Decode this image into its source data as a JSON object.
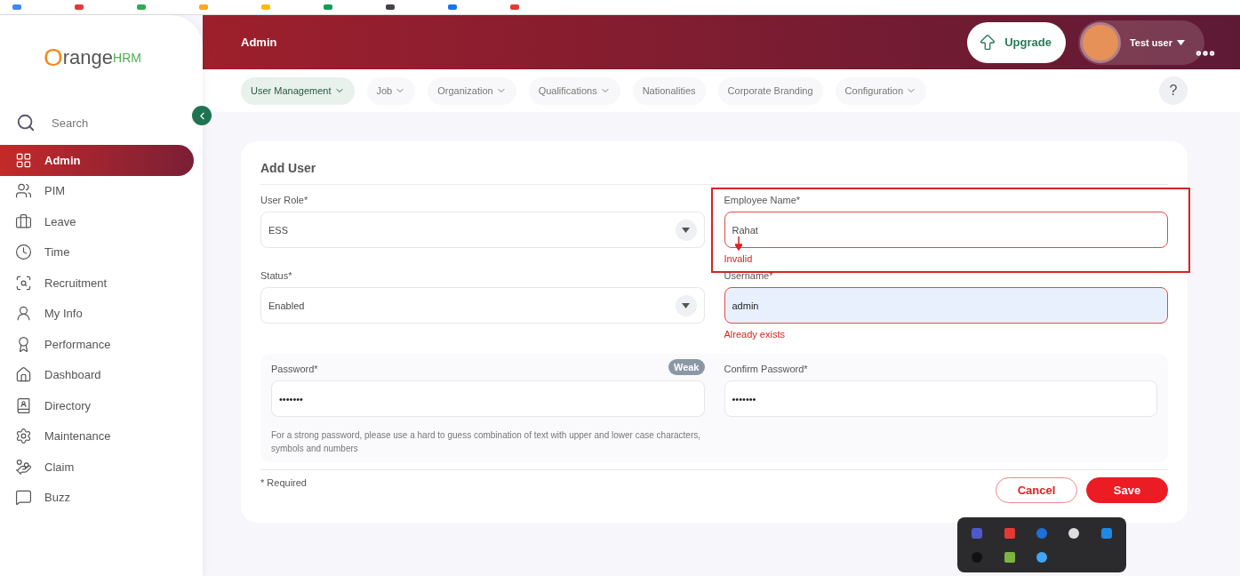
{
  "logo": {
    "main": "Orange",
    "suffix": "HRM"
  },
  "topbar": {
    "title": "Admin",
    "upgrade": "Upgrade",
    "user": "Test user"
  },
  "sidebar": {
    "search": "Search",
    "items": [
      {
        "label": "Admin",
        "selected": true
      },
      {
        "label": "PIM",
        "selected": false
      },
      {
        "label": "Leave",
        "selected": false
      },
      {
        "label": "Time",
        "selected": false
      },
      {
        "label": "Recruitment",
        "selected": false
      },
      {
        "label": "My Info",
        "selected": false
      },
      {
        "label": "Performance",
        "selected": false
      },
      {
        "label": "Dashboard",
        "selected": false
      },
      {
        "label": "Directory",
        "selected": false
      },
      {
        "label": "Maintenance",
        "selected": false
      },
      {
        "label": "Claim",
        "selected": false
      },
      {
        "label": "Buzz",
        "selected": false
      }
    ]
  },
  "nav_tabs": [
    {
      "label": "User Management",
      "dropdown": true,
      "selected": true
    },
    {
      "label": "Job",
      "dropdown": true,
      "selected": false
    },
    {
      "label": "Organization",
      "dropdown": true,
      "selected": false
    },
    {
      "label": "Qualifications",
      "dropdown": true,
      "selected": false
    },
    {
      "label": "Nationalities",
      "dropdown": false,
      "selected": false
    },
    {
      "label": "Corporate Branding",
      "dropdown": false,
      "selected": false
    },
    {
      "label": "Configuration",
      "dropdown": true,
      "selected": false
    }
  ],
  "help": "?",
  "form": {
    "title": "Add User",
    "fields": [
      {
        "kind": "select",
        "label": "User Role*",
        "value": "ESS"
      },
      {
        "kind": "text",
        "label": "Employee Name*",
        "value": "Rahat",
        "error": "Invalid",
        "annotated": true,
        "autofilled": false
      },
      {
        "kind": "select",
        "label": "Status*",
        "value": "Enabled"
      },
      {
        "kind": "text",
        "label": "Username*",
        "value": "admin",
        "error": "Already exists",
        "autofilled": true
      }
    ],
    "password": {
      "label": "Password*",
      "value": "•••••••",
      "strength": "Weak",
      "hint": "For a strong password, please use a hard to guess combination of text with upper and lower case characters, symbols and numbers"
    },
    "confirm_password": {
      "label": "Confirm Password*",
      "value": "•••••••"
    },
    "required_note": "* Required",
    "buttons": [
      {
        "kind": "cancel",
        "label": "Cancel"
      },
      {
        "kind": "save",
        "label": "Save"
      }
    ]
  }
}
